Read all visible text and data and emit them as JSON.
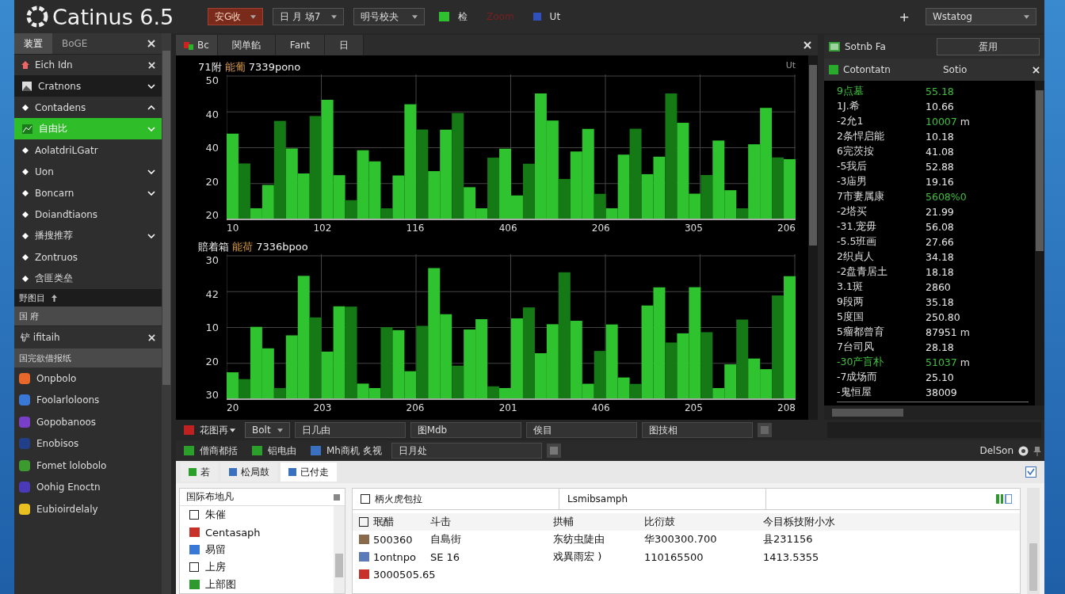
{
  "top_bar": {
    "title": "Catinus 6.5",
    "dropdowns": [
      {
        "label": "安G收",
        "kind": "accent"
      },
      {
        "label": "日 月 场7",
        "kind": "plain"
      },
      {
        "label": "明号校夬",
        "kind": "plain"
      }
    ],
    "tools": [
      {
        "label": "检",
        "kind": "green"
      },
      {
        "label": "Zoom",
        "kind": "dim"
      },
      {
        "label": "Ut",
        "kind": "blue"
      }
    ],
    "add": "+",
    "workspace": "Wstatog"
  },
  "sidebar": {
    "tabs": [
      {
        "label": "装置",
        "selected": true
      },
      {
        "label": "BoGE",
        "selected": false
      }
    ],
    "panel_title": "Eich Idn",
    "items": [
      {
        "label": "Cratnons",
        "kind": "image",
        "expanded": false,
        "selected": false
      },
      {
        "label": "Contadens",
        "kind": "bullet",
        "expanded": true,
        "selected": false
      },
      {
        "label": "自由比",
        "kind": "chart",
        "expanded": false,
        "selected": true
      },
      {
        "label": "AolatdriLGatr",
        "kind": "bullet",
        "selected": false
      },
      {
        "label": "Uon",
        "kind": "bullet",
        "expanded": false,
        "selected": false
      },
      {
        "label": "Boncarn",
        "kind": "bullet",
        "expanded": false,
        "selected": false
      },
      {
        "label": "Doiandtiaons",
        "kind": "bullet",
        "selected": false
      },
      {
        "label": "播搜推荐",
        "kind": "bullet",
        "expanded": false,
        "selected": false
      },
      {
        "label": "Zontruos",
        "kind": "bullet",
        "selected": false
      },
      {
        "label": "含匪类垒",
        "kind": "bullet",
        "selected": false
      }
    ],
    "section_1": "野图目",
    "section_2": "国 府",
    "panel_2_title": "铲 ifitaih",
    "group_title": "国完欲借报纸",
    "apps": [
      {
        "label": "Onpbolo",
        "color": "#e8672a"
      },
      {
        "label": "Foolarloloons",
        "color": "#3a78d8"
      },
      {
        "label": "Gopobanoos",
        "color": "#7a3fc8"
      },
      {
        "label": "Enobisos",
        "color": "#22408a"
      },
      {
        "label": "Fomet lolobolo",
        "color": "#3c9a2e"
      },
      {
        "label": "Oohig Enoctn",
        "color": "#4a3ab8"
      },
      {
        "label": "Eubioirdelaly",
        "color": "#e8c020"
      }
    ]
  },
  "editor": {
    "tabs": [
      {
        "label": "Bc",
        "selected": true
      },
      {
        "label": "関单餡",
        "selected": false
      },
      {
        "label": "Fant",
        "selected": false
      },
      {
        "label": "日",
        "selected": false
      }
    ],
    "corner": "Ut",
    "charts": [
      {
        "title": "71附",
        "title_accent": "能葡",
        "title_rest": "7339pono",
        "y_labels": [
          "50",
          "40",
          "40",
          "20",
          "20"
        ],
        "x_labels": [
          "10",
          "102",
          "116",
          "406",
          "206",
          "305",
          "206"
        ]
      },
      {
        "title": "賠着箱",
        "title_accent": "能荷",
        "title_rest": "7336bpoo",
        "y_labels": [
          "30",
          "42",
          "10",
          "20",
          "30"
        ],
        "x_labels": [
          "20",
          "203",
          "206",
          "201",
          "406",
          "205",
          "208"
        ]
      }
    ]
  },
  "inspector": {
    "title": "Sotnb Fa",
    "dropdown": "蛋用",
    "columns": [
      "Cotontatn",
      "Sotio"
    ],
    "rows": [
      {
        "name": "9点墓",
        "value": "55.18",
        "color": "#3fbf3f",
        "name_highlight": true
      },
      {
        "name": "1J.希",
        "value": "10.66",
        "color": "#e8e8e8",
        "name_highlight": false
      },
      {
        "name": "-2允1",
        "value": "10007",
        "unit": "m",
        "color": "#3fbf3f",
        "name_highlight": false
      },
      {
        "name": "2条悍启能",
        "value": "10.18",
        "color": "#e8e8e8",
        "name_highlight": false
      },
      {
        "name": "6完茨按",
        "value": "41.08",
        "color": "#e8e8e8",
        "name_highlight": false
      },
      {
        "name": "-5我后",
        "value": "52.88",
        "color": "#e8e8e8",
        "name_highlight": false
      },
      {
        "name": "-3庙男",
        "value": "19.16",
        "color": "#e8e8e8",
        "name_highlight": false
      },
      {
        "name": "7市妻属康",
        "value": "5608%0",
        "color": "#3fbf3f",
        "name_highlight": false
      },
      {
        "name": "-2塔买",
        "value": "21.99",
        "color": "#e8e8e8",
        "name_highlight": false
      },
      {
        "name": "-31.宠毋",
        "value": "56.08",
        "color": "#e8e8e8",
        "name_highlight": false
      },
      {
        "name": "-5.5班画",
        "value": "27.66",
        "color": "#e8e8e8",
        "name_highlight": false
      },
      {
        "name": "2织貞人",
        "value": "34.18",
        "color": "#e8e8e8",
        "name_highlight": false
      },
      {
        "name": "-2盘青居土",
        "value": "18.18",
        "color": "#e8e8e8",
        "name_highlight": false
      },
      {
        "name": "3.1斑",
        "value": "2860",
        "color": "#e8e8e8",
        "name_highlight": false
      },
      {
        "name": "9段两",
        "value": "35.18",
        "color": "#e8e8e8",
        "name_highlight": false
      },
      {
        "name": "5度国",
        "value": "250.80",
        "color": "#e8e8e8",
        "name_highlight": false
      },
      {
        "name": "5瘤都曾育",
        "value": "87951",
        "unit": "m",
        "color": "#e8e8e8",
        "name_highlight": false
      },
      {
        "name": "7台司风",
        "value": "28.18",
        "color": "#e8e8e8",
        "name_highlight": false
      },
      {
        "name": "-30产盲朴",
        "value": "51037",
        "unit": "m",
        "color": "#3fbf3f",
        "name_highlight": true
      },
      {
        "name": "-7成场而",
        "value": "25.10",
        "color": "#e8e8e8",
        "name_highlight": false
      },
      {
        "name": "-鬼恒屋",
        "value": "38009",
        "color": "#e8e8e8",
        "name_highlight": false
      }
    ]
  },
  "toolbar_1": {
    "menu": "花图再",
    "dropdown": "Bolt",
    "fields": [
      "日几由",
      "图Mdb",
      "俟目",
      "图技相"
    ]
  },
  "toolbar_2": {
    "buttons": [
      "僧商都括",
      "铝电由",
      "Mh商机 炙视"
    ],
    "field": "日月处",
    "status": "DelSon"
  },
  "bottom": {
    "tabs": [
      {
        "label": "若",
        "selected": false
      },
      {
        "label": "松局鼓",
        "selected": false
      },
      {
        "label": "已付走",
        "selected": true
      }
    ],
    "list_title": "国际布地凡",
    "list": [
      {
        "label": "朱催",
        "kind": "checkbox"
      },
      {
        "label": "Centasaph",
        "kind": "red"
      },
      {
        "label": "易留",
        "kind": "blue"
      },
      {
        "label": "上房",
        "kind": "checkbox"
      },
      {
        "label": "上部图",
        "kind": "green"
      }
    ],
    "filters": [
      "柄火虎包拉",
      "Lsmibsamph"
    ],
    "columns": [
      "珉醋",
      "斗击",
      "拱輔",
      "比衍鼓",
      "今目栎技附小水"
    ],
    "rows": [
      {
        "kind": "image",
        "cells": [
          "500360",
          "自島街",
          "东纺虫陡由",
          "华300300.700",
          "县231156"
        ]
      },
      {
        "kind": "doc",
        "cells": [
          "1ontnpo",
          "SE 16",
          "戏異雨宏 )",
          "110165500",
          "1413.5355"
        ]
      },
      {
        "kind": "clock",
        "cells": [
          "3000505.65"
        ]
      }
    ]
  }
}
